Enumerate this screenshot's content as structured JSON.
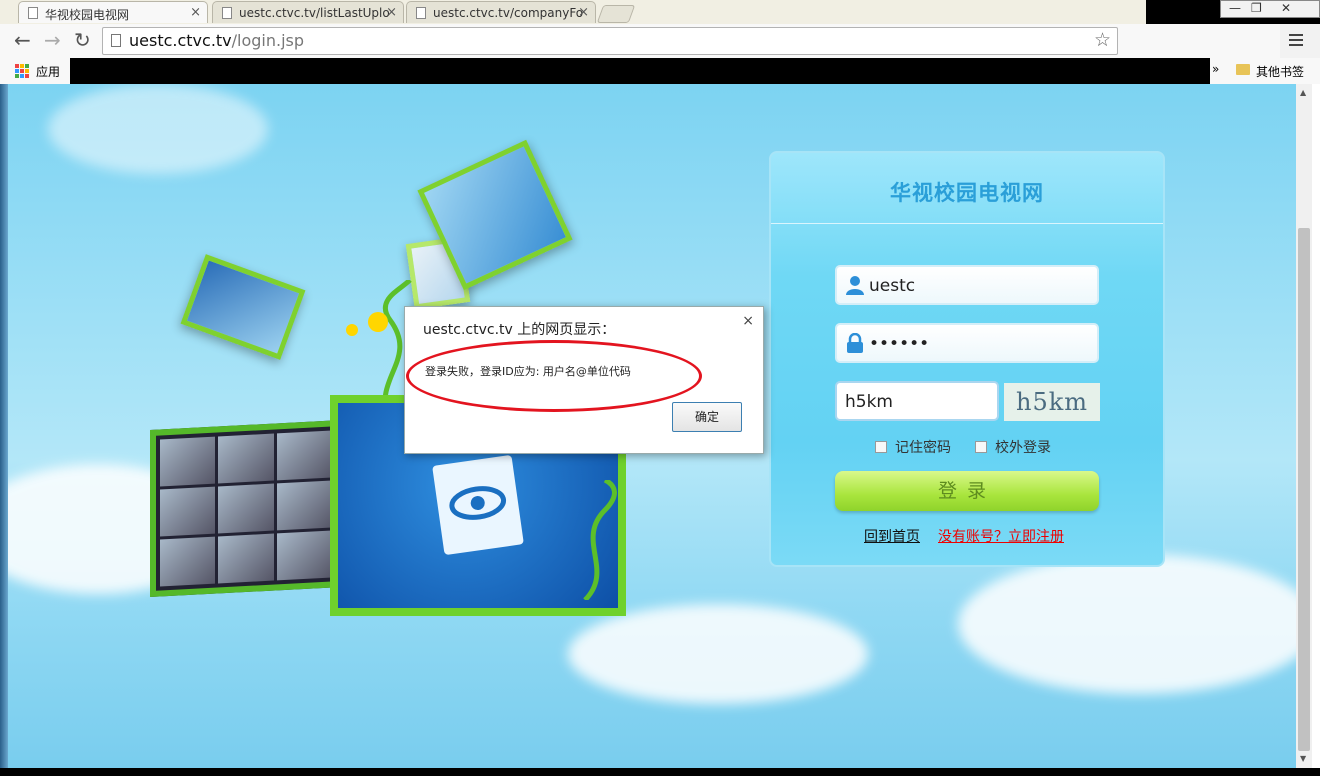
{
  "browser": {
    "tabs": [
      {
        "title": "华视校园电视网",
        "active": true
      },
      {
        "title": "uestc.ctvc.tv/listLastUplo",
        "active": false
      },
      {
        "title": "uestc.ctvc.tv/companyFo",
        "active": false
      }
    ],
    "url_host": "uestc.ctvc.tv",
    "url_path": "/login.jsp",
    "bookmarks": {
      "apps_label": "应用",
      "other_label": "其他书签",
      "overflow": "»"
    }
  },
  "login": {
    "title": "华视校园电视网",
    "username": "uestc",
    "password_mask": "••••••",
    "captcha_input": "h5km",
    "captcha_image_text": "h5km",
    "remember_label": "记住密码",
    "offcampus_label": "校外登录",
    "submit_label": "登录",
    "home_link": "回到首页",
    "register_link": "没有账号？立即注册"
  },
  "dialog": {
    "title": "uestc.ctvc.tv 上的网页显示：",
    "message": "登录失败，登录ID应为: 用户名@单位代码",
    "ok_label": "确定",
    "close_glyph": "×"
  },
  "colors": {
    "accent_red": "#e3141f",
    "title_blue": "#2a9fd8",
    "button_green": "#a9e53d"
  }
}
